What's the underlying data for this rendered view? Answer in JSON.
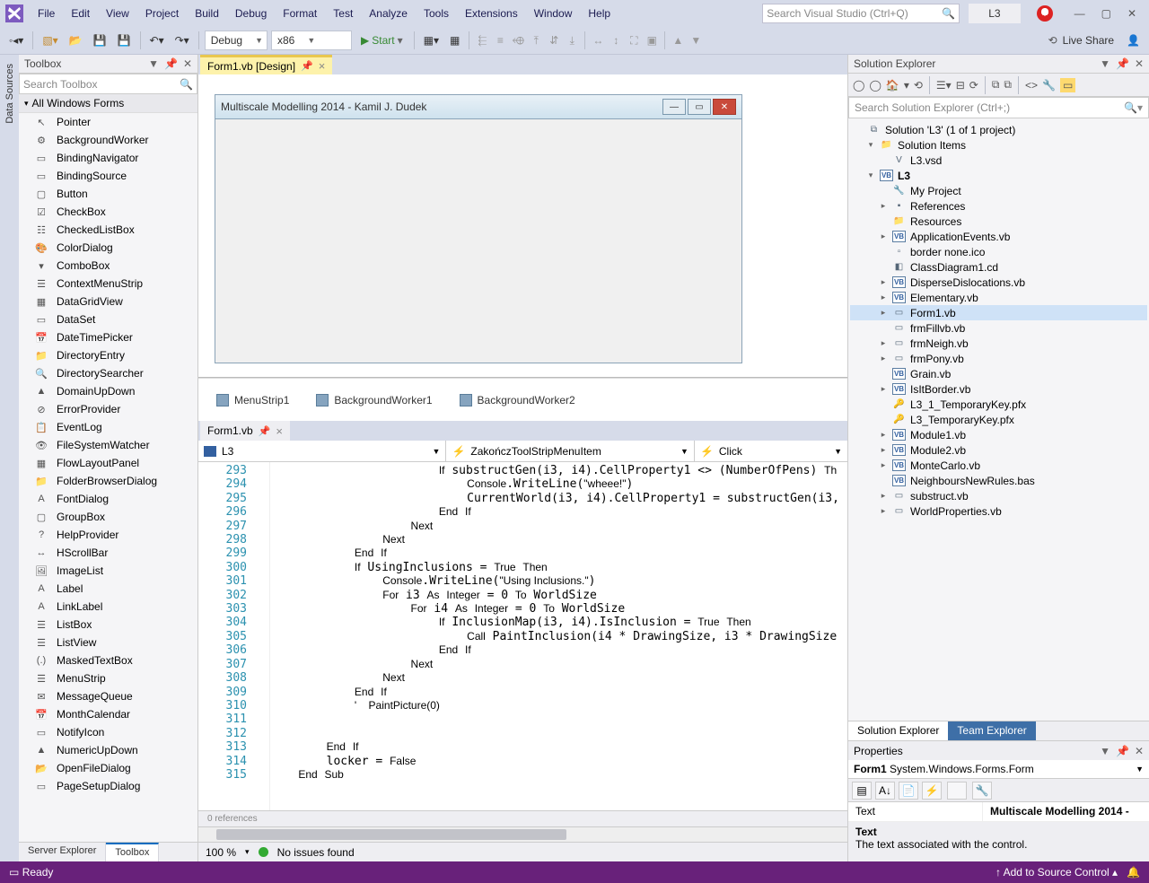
{
  "title_menus": [
    "File",
    "Edit",
    "View",
    "Project",
    "Build",
    "Debug",
    "Format",
    "Test",
    "Analyze",
    "Tools",
    "Extensions",
    "Window",
    "Help"
  ],
  "search_placeholder": "Search Visual Studio (Ctrl+Q)",
  "solution_pill": "L3",
  "toolbar": {
    "config": "Debug",
    "platform": "x86",
    "start": "Start",
    "liveshare": "Live Share"
  },
  "left_rail": "Data Sources",
  "toolbox": {
    "title": "Toolbox",
    "search": "Search Toolbox",
    "category": "All Windows Forms",
    "items": [
      "Pointer",
      "BackgroundWorker",
      "BindingNavigator",
      "BindingSource",
      "Button",
      "CheckBox",
      "CheckedListBox",
      "ColorDialog",
      "ComboBox",
      "ContextMenuStrip",
      "DataGridView",
      "DataSet",
      "DateTimePicker",
      "DirectoryEntry",
      "DirectorySearcher",
      "DomainUpDown",
      "ErrorProvider",
      "EventLog",
      "FileSystemWatcher",
      "FlowLayoutPanel",
      "FolderBrowserDialog",
      "FontDialog",
      "GroupBox",
      "HelpProvider",
      "HScrollBar",
      "ImageList",
      "Label",
      "LinkLabel",
      "ListBox",
      "ListView",
      "MaskedTextBox",
      "MenuStrip",
      "MessageQueue",
      "MonthCalendar",
      "NotifyIcon",
      "NumericUpDown",
      "OpenFileDialog",
      "PageSetupDialog"
    ],
    "bottom_tabs": {
      "server": "Server Explorer",
      "toolbox": "Toolbox"
    }
  },
  "designer_tab": "Form1.vb [Design]",
  "form_title": "Multiscale Modelling 2014 - Kamil J. Dudek",
  "tray": [
    "MenuStrip1",
    "BackgroundWorker1",
    "BackgroundWorker2"
  ],
  "code_tab": "Form1.vb",
  "nav": {
    "left": "L3",
    "mid": "ZakończToolStripMenuItem",
    "right": "Click"
  },
  "code_start": 293,
  "code_lines": [
    "                        <kw>If</kw> substructGen(i3, i4).CellProperty1 &lt;&gt; (NumberOfPens) <kw>Th</kw>",
    "                            <type>Console</type>.WriteLine(<str>\"wheee!\"</str>)",
    "                            CurrentWorld(i3, i4).CellProperty1 = substructGen(i3,",
    "                        <kw>End</kw> <kw>If</kw>",
    "                    <kw>Next</kw>",
    "                <kw>Next</kw>",
    "            <kw>End</kw> <kw>If</kw>",
    "            <kw>If</kw> UsingInclusions = <kw>True</kw> <kw>Then</kw>",
    "                <type>Console</type>.WriteLine(<str>\"Using Inclusions.\"</str>)",
    "                <kw>For</kw> i3 <kw>As</kw> <kw>Integer</kw> = 0 <kw>To</kw> WorldSize",
    "                    <kw>For</kw> i4 <kw>As</kw> <kw>Integer</kw> = 0 <kw>To</kw> WorldSize",
    "                        <kw>If</kw> InclusionMap(i3, i4).IsInclusion = <kw>True</kw> <kw>Then</kw>",
    "                            <kw>Call</kw> PaintInclusion(i4 * DrawingSize, i3 * DrawingSize",
    "                        <kw>End</kw> <kw>If</kw>",
    "                    <kw>Next</kw>",
    "                <kw>Next</kw>",
    "            <kw>End</kw> <kw>If</kw>",
    "            <cmt>'    PaintPicture(0)</cmt>",
    "",
    "",
    "        <kw>End</kw> <kw>If</kw>",
    "        locker = <kw>False</kw>",
    "    <kw>End</kw> <kw>Sub</kw>"
  ],
  "refs": "0 references",
  "zoom": "100 %",
  "issues": "No issues found",
  "se": {
    "title": "Solution Explorer",
    "search": "Search Solution Explorer (Ctrl+;)",
    "tree": [
      {
        "ind": 0,
        "exp": "",
        "ico": "sln",
        "label": "Solution 'L3' (1 of 1 project)"
      },
      {
        "ind": 1,
        "exp": "▾",
        "ico": "fold",
        "label": "Solution Items"
      },
      {
        "ind": 2,
        "exp": "",
        "ico": "vsd",
        "label": "L3.vsd"
      },
      {
        "ind": 1,
        "exp": "▾",
        "ico": "vb",
        "label": "L3",
        "bold": true
      },
      {
        "ind": 2,
        "exp": "",
        "ico": "wr",
        "label": "My Project"
      },
      {
        "ind": 2,
        "exp": "▸",
        "ico": "ref",
        "label": "References"
      },
      {
        "ind": 2,
        "exp": "",
        "ico": "fold",
        "label": "Resources"
      },
      {
        "ind": 2,
        "exp": "▸",
        "ico": "vb",
        "label": "ApplicationEvents.vb"
      },
      {
        "ind": 2,
        "exp": "",
        "ico": "ico",
        "label": "border none.ico"
      },
      {
        "ind": 2,
        "exp": "",
        "ico": "cd",
        "label": "ClassDiagram1.cd"
      },
      {
        "ind": 2,
        "exp": "▸",
        "ico": "vb",
        "label": "DisperseDislocations.vb"
      },
      {
        "ind": 2,
        "exp": "▸",
        "ico": "vb",
        "label": "Elementary.vb"
      },
      {
        "ind": 2,
        "exp": "▸",
        "ico": "frm",
        "label": "Form1.vb",
        "sel": true
      },
      {
        "ind": 2,
        "exp": "",
        "ico": "frm",
        "label": "frmFillvb.vb"
      },
      {
        "ind": 2,
        "exp": "▸",
        "ico": "frm",
        "label": "frmNeigh.vb"
      },
      {
        "ind": 2,
        "exp": "▸",
        "ico": "frm",
        "label": "frmPony.vb"
      },
      {
        "ind": 2,
        "exp": "",
        "ico": "vb",
        "label": "Grain.vb"
      },
      {
        "ind": 2,
        "exp": "▸",
        "ico": "vb",
        "label": "IsItBorder.vb"
      },
      {
        "ind": 2,
        "exp": "",
        "ico": "pfx",
        "label": "L3_1_TemporaryKey.pfx"
      },
      {
        "ind": 2,
        "exp": "",
        "ico": "pfx",
        "label": "L3_TemporaryKey.pfx"
      },
      {
        "ind": 2,
        "exp": "▸",
        "ico": "vb",
        "label": "Module1.vb"
      },
      {
        "ind": 2,
        "exp": "▸",
        "ico": "vb",
        "label": "Module2.vb"
      },
      {
        "ind": 2,
        "exp": "▸",
        "ico": "vb",
        "label": "MonteCarlo.vb"
      },
      {
        "ind": 2,
        "exp": "",
        "ico": "vb",
        "label": "NeighboursNewRules.bas"
      },
      {
        "ind": 2,
        "exp": "▸",
        "ico": "frm",
        "label": "substruct.vb"
      },
      {
        "ind": 2,
        "exp": "▸",
        "ico": "frm",
        "label": "WorldProperties.vb"
      }
    ],
    "tabs": {
      "se": "Solution Explorer",
      "te": "Team Explorer"
    }
  },
  "props": {
    "title": "Properties",
    "obj": "Form1",
    "type": "System.Windows.Forms.Form",
    "row_key": "Text",
    "row_val": "Multiscale Modelling 2014 - ",
    "desc_title": "Text",
    "desc_body": "The text associated with the control."
  },
  "status": {
    "ready": "Ready",
    "src": "Add to Source Control"
  }
}
